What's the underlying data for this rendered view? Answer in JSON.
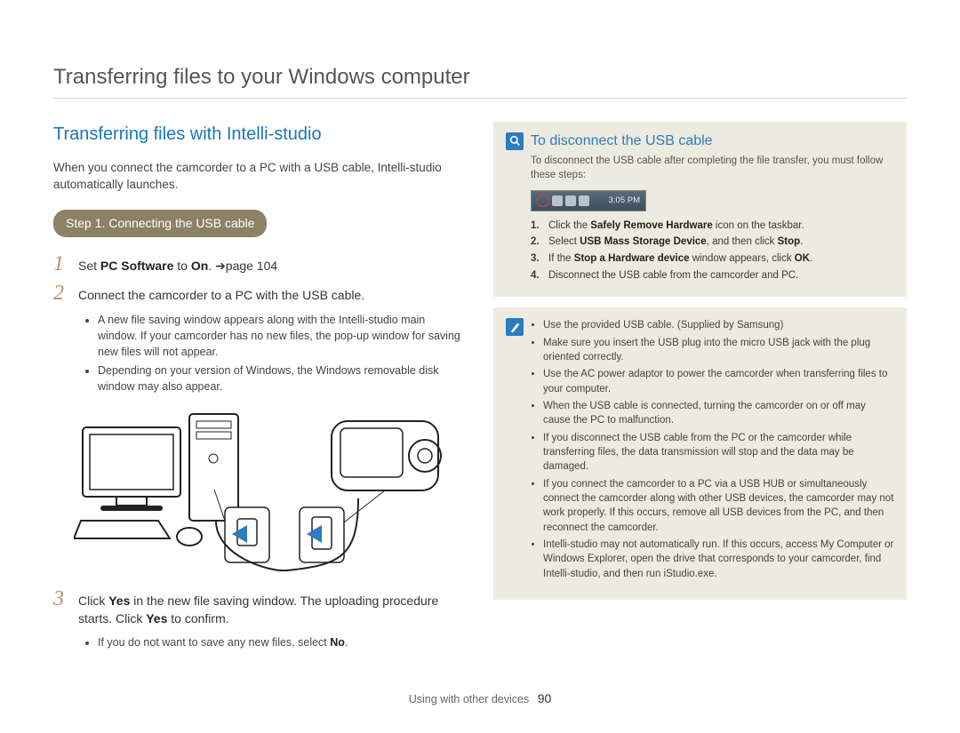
{
  "header": {
    "title": "Transferring files to your Windows computer"
  },
  "left": {
    "section_heading": "Transferring files with Intelli-studio",
    "intro": "When you connect the camcorder to a PC with a USB cable, Intelli-studio automatically launches.",
    "step_badge": "Step 1. Connecting the USB cable",
    "item1_prefix": "Set ",
    "item1_kw": "PC Software",
    "item1_mid": " to ",
    "item1_kw2": "On",
    "item1_suffix": ". ➔page 104",
    "item2": "Connect the camcorder to a PC with the USB cable.",
    "item2_b1": "A new file saving window appears along with the Intelli-studio main window. If your camcorder has no new files, the pop-up window for saving new files will not appear.",
    "item2_b2": "Depending on your version of Windows, the Windows removable disk window may also appear.",
    "item3_pre": "Click ",
    "item3_kw": "Yes",
    "item3_mid": " in the new file saving window. The uploading procedure starts. Click ",
    "item3_kw2": "Yes",
    "item3_end": " to confirm.",
    "item3_b1_pre": "If you do not want to save any new files, select ",
    "item3_b1_kw": "No",
    "item3_b1_end": "."
  },
  "right": {
    "panel1_title": "To disconnect the USB cable",
    "panel1_sub": "To disconnect the USB cable after completing the file transfer, you must follow these steps:",
    "taskbar_time": "3:05 PM",
    "n1_pre": "Click the ",
    "n1_kw": "Safely Remove Hardware",
    "n1_end": " icon on the taskbar.",
    "n2_pre": "Select ",
    "n2_kw": "USB Mass Storage Device",
    "n2_mid": ", and then click ",
    "n2_kw2": "Stop",
    "n2_end": ".",
    "n3_pre": "If the ",
    "n3_kw": "Stop a Hardware device",
    "n3_mid": " window appears, click ",
    "n3_kw2": "OK",
    "n3_end": ".",
    "n4": "Disconnect the USB cable from the camcorder and PC.",
    "p2_b1": "Use the provided USB cable. (Supplied by Samsung)",
    "p2_b2": "Make sure you insert the USB plug into the micro USB jack with the plug oriented correctly.",
    "p2_b3": "Use the AC power adaptor to power the camcorder when transferring files to your computer.",
    "p2_b4": "When the USB cable is connected, turning the camcorder on or off may cause the PC to malfunction.",
    "p2_b5": "If you disconnect the USB cable from the PC or the camcorder while transferring files, the data transmission will stop and the data may be damaged.",
    "p2_b6": "If you connect the camcorder to a PC via a USB HUB or simultaneously connect the camcorder along with other USB devices, the camcorder may not work properly. If this occurs, remove all USB devices from the PC, and then reconnect the camcorder.",
    "p2_b7": "Intelli-studio may not automatically run. If this occurs, access My Computer or Windows Explorer, open the drive that corresponds to your camcorder, find Intelli-studio, and then run iStudio.exe."
  },
  "footer": {
    "label": "Using with other devices",
    "page": "90"
  }
}
